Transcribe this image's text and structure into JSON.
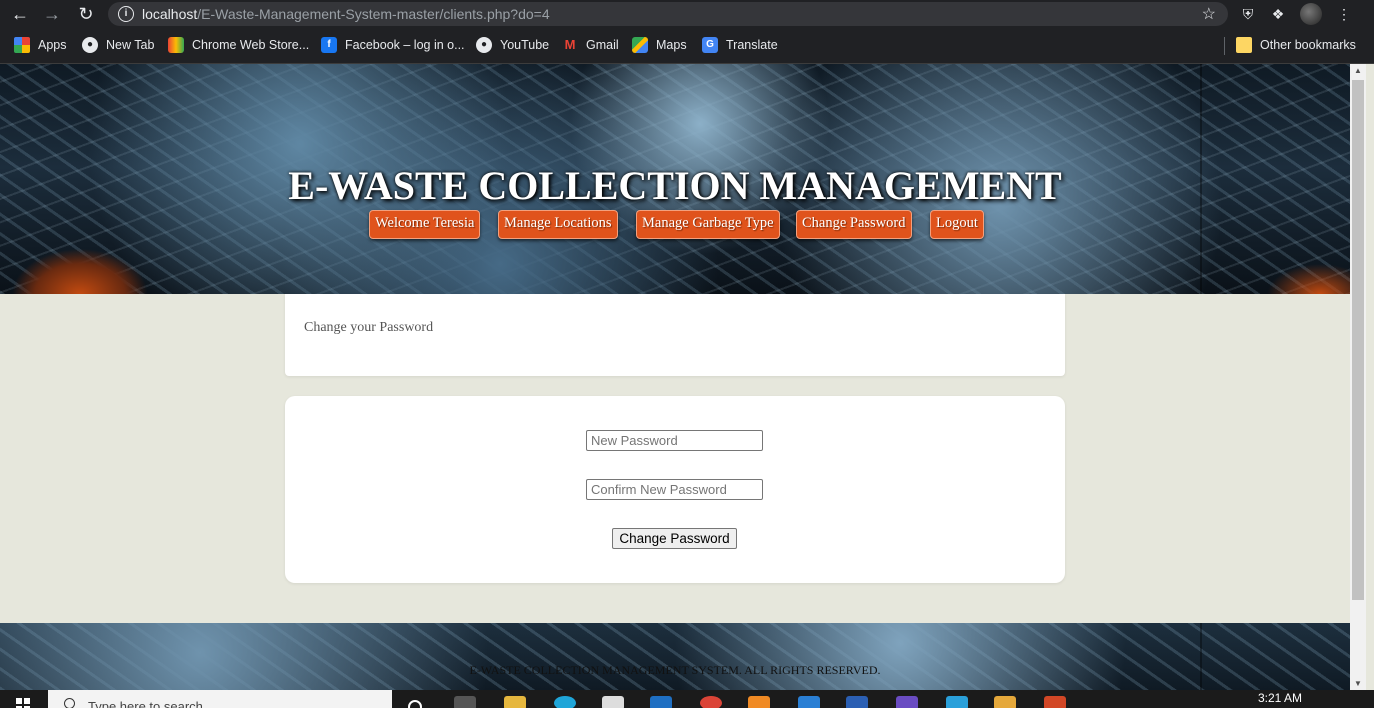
{
  "browser": {
    "url_host": "localhost",
    "url_path": "/E-Waste-Management-System-master/clients.php?do=4",
    "bookmarks": [
      {
        "label": "Apps",
        "icon": "apps-grid-icon"
      },
      {
        "label": "New Tab",
        "icon": "globe-icon"
      },
      {
        "label": "Chrome Web Store...",
        "icon": "webstore-icon"
      },
      {
        "label": "Facebook – log in o...",
        "icon": "facebook-icon"
      },
      {
        "label": "YouTube",
        "icon": "globe-icon"
      },
      {
        "label": "Gmail",
        "icon": "gmail-icon"
      },
      {
        "label": "Maps",
        "icon": "maps-icon"
      },
      {
        "label": "Translate",
        "icon": "translate-icon"
      }
    ],
    "other_bookmarks": "Other bookmarks"
  },
  "site": {
    "title": "E-WASTE COLLECTION MANAGEMENT",
    "menu": [
      {
        "label": "Welcome Teresia"
      },
      {
        "label": "Manage Locations"
      },
      {
        "label": "Manage Garbage Type"
      },
      {
        "label": "Change Password"
      },
      {
        "label": "Logout"
      }
    ]
  },
  "page": {
    "heading": "Change your Password",
    "form": {
      "new_password_placeholder": "New Password",
      "confirm_password_placeholder": "Confirm New Password",
      "submit_label": "Change Password"
    },
    "footer": "E-WASTE COLLECTION MANAGEMENT SYSTEM. ALL RIGHTS RESERVED."
  },
  "taskbar": {
    "search_placeholder": "Type here to search",
    "clock": "3:21 AM"
  },
  "colors": {
    "menu_button": "#e0531c",
    "page_background": "#e6e7dc",
    "chrome_dark": "#202124"
  }
}
